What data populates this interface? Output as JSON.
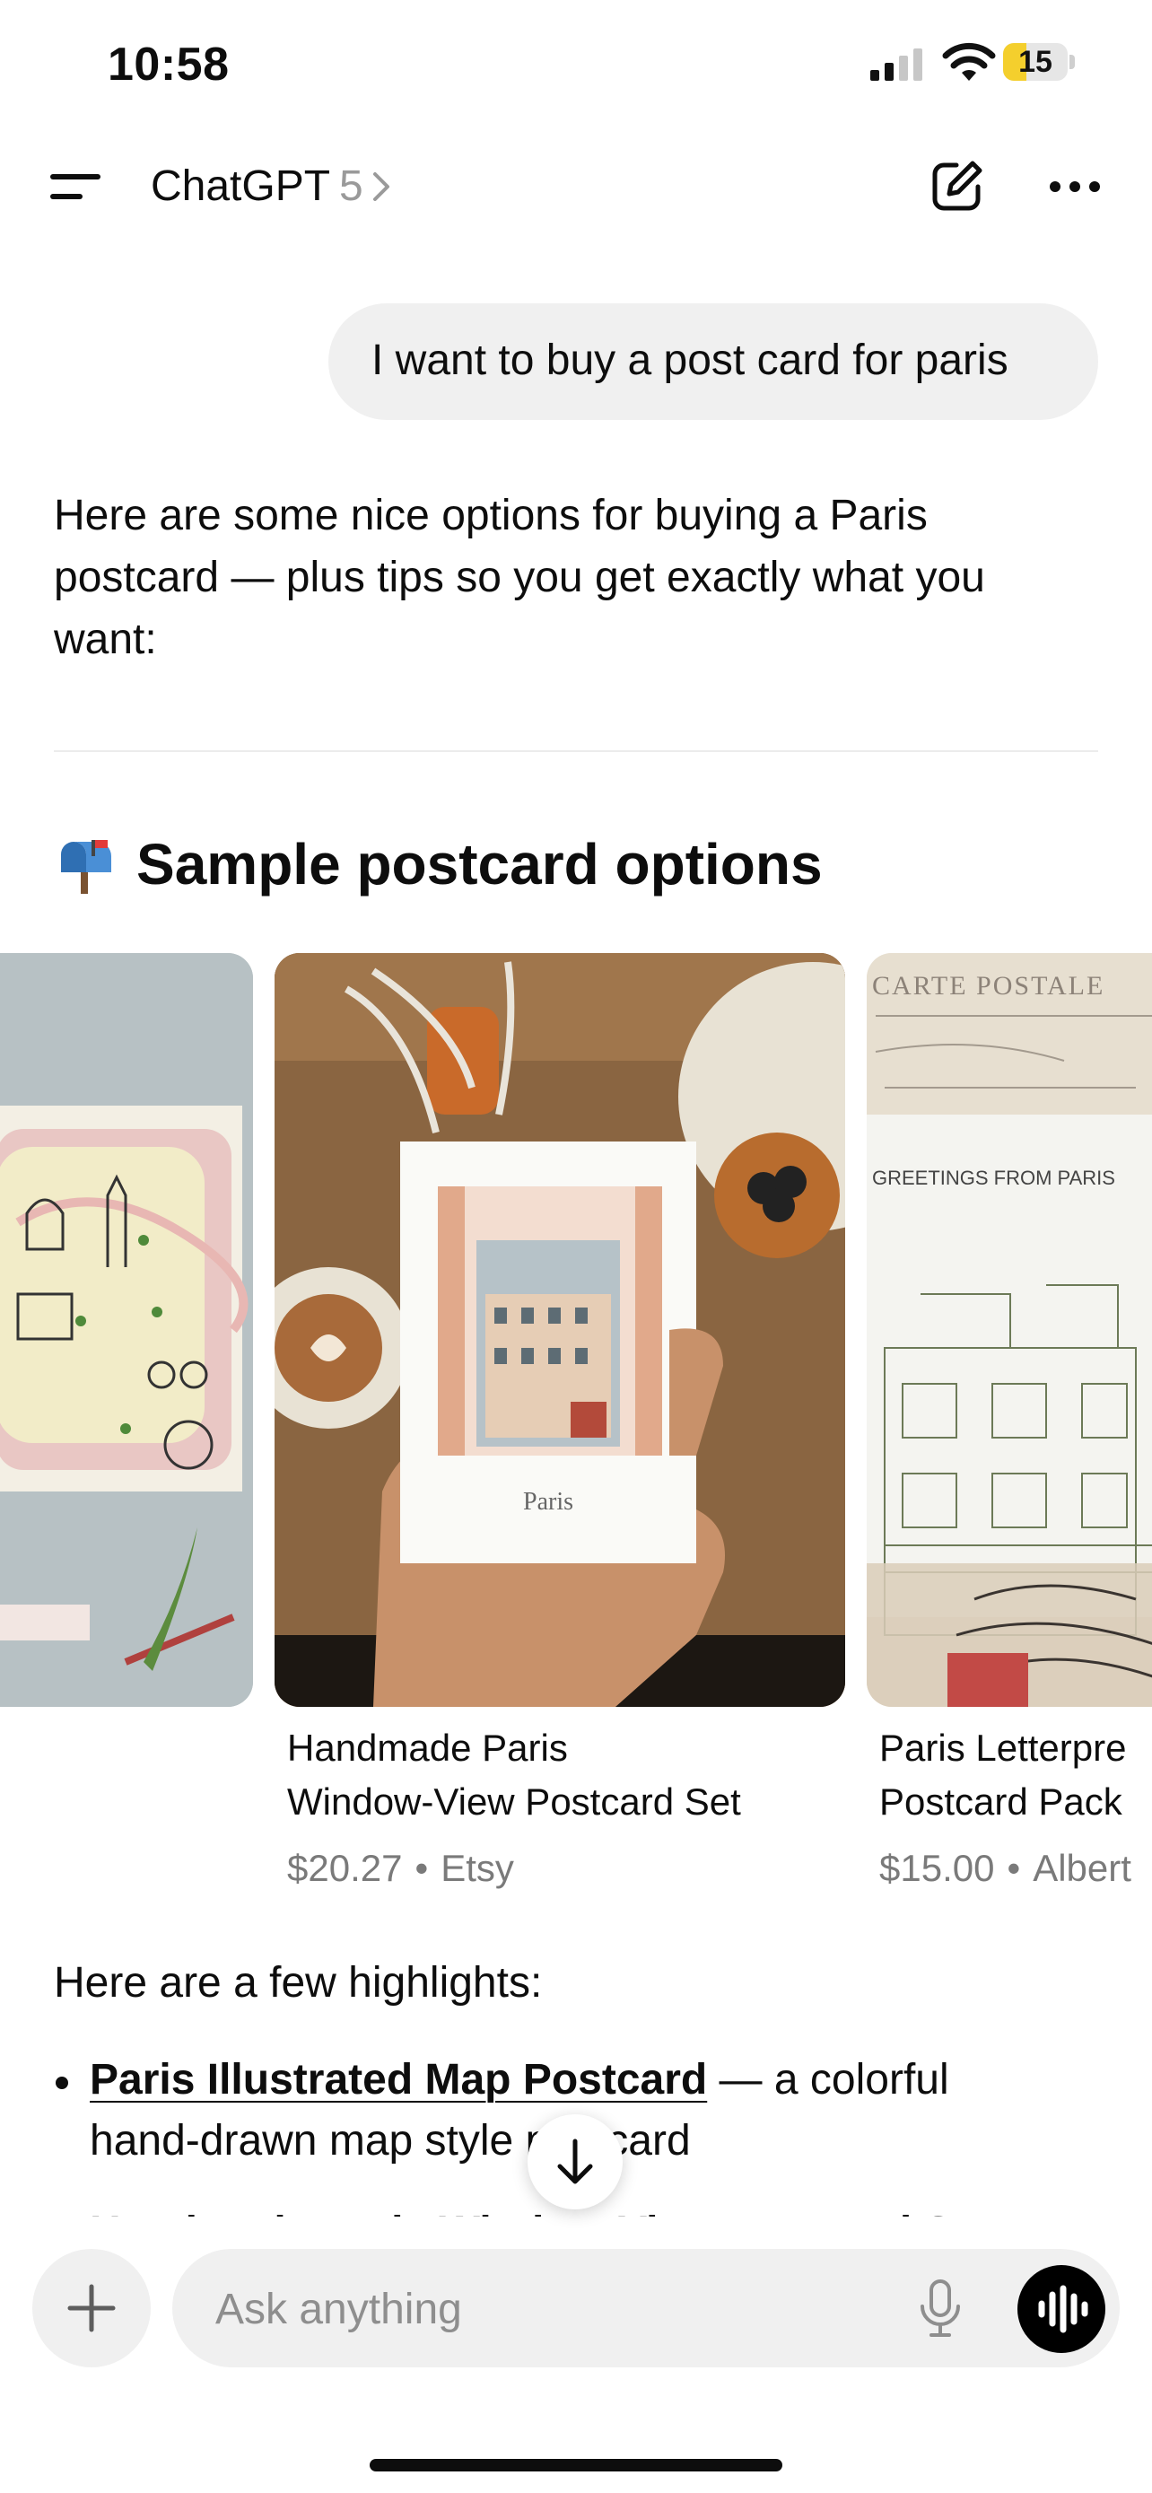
{
  "status_bar": {
    "time": "10:58",
    "battery": "15",
    "battery_level": 0.15
  },
  "header": {
    "title": "ChatGPT",
    "model": "5"
  },
  "user_message": "I want to buy a post card for paris",
  "assistant": {
    "intro": "Here are some nice options for buying a Paris postcard — plus tips so you get exactly what you want:",
    "section_emoji": "mailbox-icon",
    "section_title": "Sample postcard options",
    "products": [
      {
        "image": "illustrated-map-postcard-image",
        "title_lines": [],
        "price": "",
        "seller": ""
      },
      {
        "image": "window-view-postcard-image",
        "title_lines": [
          "Handmade Paris",
          "Window-View Postcard Set"
        ],
        "price": "$20.27",
        "seller": "Etsy",
        "image_text": "Paris"
      },
      {
        "image": "letterpress-postcard-image",
        "title_lines": [
          "Paris Letterpre",
          "Postcard Pack"
        ],
        "price": "$15.00",
        "seller": "Albert",
        "image_text": [
          "CARTE POSTALE",
          "GREETINGS FROM PARIS"
        ]
      }
    ],
    "highlights_heading": "Here are a few highlights:",
    "highlights": [
      {
        "link": "Paris Illustrated Map Postcard",
        "line1_rest": " — a colorful",
        "line2": "hand-drawn map style postcard"
      },
      {
        "link": "Handmade Paris Window-View Postcard Set"
      }
    ]
  },
  "composer": {
    "placeholder": "Ask anything"
  },
  "colors": {
    "bubble": "#f0f0f0",
    "battery": "#f4cf2d",
    "muted": "#8e8e8e"
  }
}
